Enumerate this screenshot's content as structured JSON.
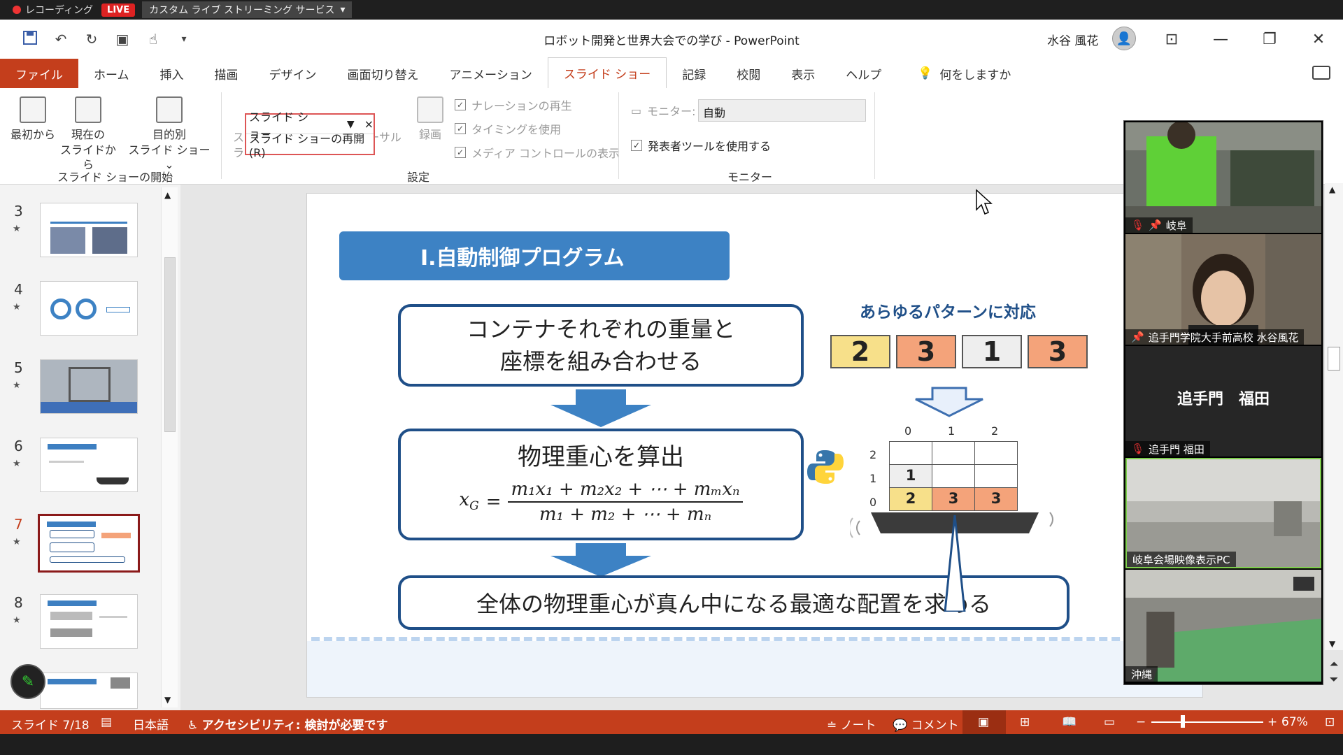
{
  "recording": {
    "status": "レコーディング",
    "live": "LIVE",
    "service": "カスタム ライブ ストリーミング サービス",
    "dropdown_icon": "▾"
  },
  "titlebar": {
    "document_title": "ロボット開発と世界大会での学び  -  PowerPoint",
    "user_name": "水谷 風花",
    "qat_icons": [
      "save-icon",
      "undo-icon",
      "redo-icon",
      "present-icon",
      "touch-icon"
    ]
  },
  "tabs": [
    {
      "label": "ファイル",
      "kind": "file"
    },
    {
      "label": "ホーム"
    },
    {
      "label": "挿入"
    },
    {
      "label": "描画"
    },
    {
      "label": "デザイン"
    },
    {
      "label": "画面切り替え"
    },
    {
      "label": "アニメーション"
    },
    {
      "label": "スライド ショー",
      "active": true
    },
    {
      "label": "記録"
    },
    {
      "label": "校閲"
    },
    {
      "label": "表示"
    },
    {
      "label": "ヘルプ"
    }
  ],
  "tell_me": "何をしますか",
  "ribbon": {
    "start": {
      "from_beginning": "最初から",
      "from_current_1": "現在の",
      "from_current_2": "スライドから",
      "custom_1": "目的別",
      "custom_2": "スライド ショー ⌄",
      "group_label": "スライド ショーの開始"
    },
    "setup": {
      "setup_hidden": "スラ",
      "rehearse": "ーサル",
      "record": "録画",
      "narration": "ナレーションの再生",
      "timings": "タイミングを使用",
      "media": "メディア コントロールの表示",
      "group_label": "設定"
    },
    "monitor": {
      "label": "モニター:",
      "value": "自動",
      "presenter_view": "発表者ツールを使用する",
      "group_label": "モニター"
    },
    "dropdown": {
      "title": "スライド ショー",
      "resume": "スライド ショーの再開(R)",
      "close": "×"
    }
  },
  "thumbnails": [
    {
      "num": "3",
      "star": "★"
    },
    {
      "num": "4",
      "star": "★"
    },
    {
      "num": "5",
      "star": "★"
    },
    {
      "num": "6",
      "star": "★"
    },
    {
      "num": "7",
      "star": "★",
      "current": true
    },
    {
      "num": "8",
      "star": "★"
    },
    {
      "num": "9",
      "star": ""
    }
  ],
  "slide": {
    "title": "Ⅰ.自動制御プログラム",
    "box1_line1": "コンテナそれぞれの重量と",
    "box1_line2": "座標を組み合わせる",
    "box2_title": "物理重心を算出",
    "formula_lhs": "x",
    "formula_lhs_sub": "G",
    "formula_num": "m₁x₁ + m₂x₂ + ⋯ + mₘxₙ",
    "formula_den": "m₁ + m₂ + ⋯ + mₙ",
    "box3": "全体の物理重心が真ん中になる最適な配置を求める",
    "pattern_title": "あらゆるパターンに対応",
    "patterns": [
      {
        "value": "2",
        "color": "#f7e08a"
      },
      {
        "value": "3",
        "color": "#f4a37a"
      },
      {
        "value": "1",
        "color": "#eeeeee"
      },
      {
        "value": "3",
        "color": "#f4a37a"
      }
    ],
    "grid_cols": [
      "0",
      "1",
      "2"
    ],
    "grid_rows": [
      "2",
      "1",
      "0"
    ],
    "grid_cells": [
      [
        "",
        "",
        ""
      ],
      [
        "1",
        "",
        ""
      ],
      [
        "2",
        "3",
        "3"
      ]
    ],
    "grid_colors": [
      [
        "#ffffff",
        "#ffffff",
        "#ffffff"
      ],
      [
        "#eeeeee",
        "#ffffff",
        "#ffffff"
      ],
      [
        "#f7e08a",
        "#f4a37a",
        "#f4a37a"
      ]
    ]
  },
  "participants": [
    {
      "label": "岐阜",
      "muted": true
    },
    {
      "label": "追手門学院大手前高校  水谷風花"
    },
    {
      "label": "追手門  福田",
      "display_name": "追手門　福田",
      "muted": true
    },
    {
      "label": "岐阜会場映像表示PC"
    },
    {
      "label": "沖縄"
    }
  ],
  "statusbar": {
    "slide": "スライド 7/18",
    "language": "日本語",
    "accessibility": "アクセシビリティ: 検討が必要です",
    "notes": "ノート",
    "comments": "コメント",
    "zoom": "67%"
  }
}
